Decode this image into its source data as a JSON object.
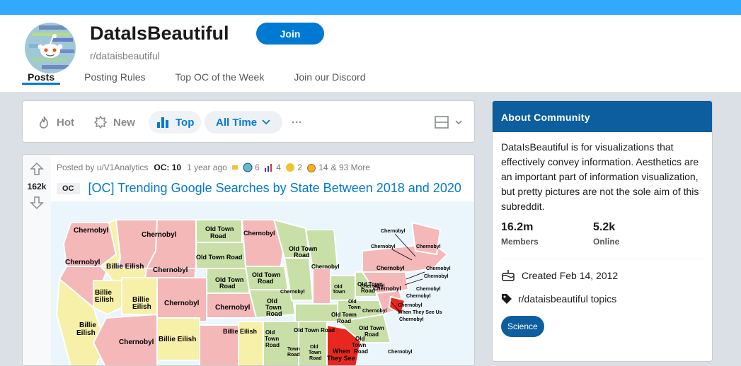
{
  "header": {
    "title": "DataIsBeautiful",
    "subreddit": "r/dataisbeautiful",
    "join_label": "Join",
    "tabs": [
      "Posts",
      "Posting Rules",
      "Top OC of the Week",
      "Join our Discord"
    ]
  },
  "sort": {
    "hot": "Hot",
    "new": "New",
    "top": "Top",
    "time": "All Time",
    "more": "···"
  },
  "post": {
    "votes": "162k",
    "posted_by": "Posted by u/V1Analytics",
    "oc": "OC: 10",
    "age": "1 year ago",
    "awards": [
      {
        "icon": "award-icon",
        "count": "6"
      },
      {
        "icon": "chart-award-icon",
        "count": "4"
      },
      {
        "icon": "hands-award-icon",
        "count": "2"
      },
      {
        "icon": "medal-award-icon",
        "count": "14"
      }
    ],
    "more_awards": "& 93 More",
    "flair": "OC",
    "title": "[OC] Trending Google Searches by State Between 2018 and 2020",
    "map_labels": {
      "chernobyl": "Chernobyl",
      "old_town_road": "Old Town Road",
      "billie_eilish": "Billie Eilish",
      "when_they_see_us": "When They See Us",
      "old": "Old",
      "town": "Town",
      "road": "Road",
      "billie": "Billie",
      "eilish": "Eilish",
      "when": "When",
      "they_see": "They See"
    }
  },
  "about": {
    "heading": "About Community",
    "description": "DataIsBeautiful is for visualizations that effectively convey information. Aesthetics are an important part of information visualization, but pretty pictures are not the sole aim of this subreddit.",
    "members_value": "16.2m",
    "members_label": "Members",
    "online_value": "5.2k",
    "online_label": "Online",
    "created": "Created Feb 14, 2012",
    "topics": "r/dataisbeautiful topics",
    "topic_chip": "Science"
  },
  "colors": {
    "banner": "#33a8ff",
    "accent": "#0079d3",
    "about_header": "#0d5e9f",
    "chernobyl": "#f4b8b8",
    "old_town_road": "#c8e0a8",
    "billie_eilish": "#f6f0a8",
    "when_they_see_us": "#e8271e"
  }
}
